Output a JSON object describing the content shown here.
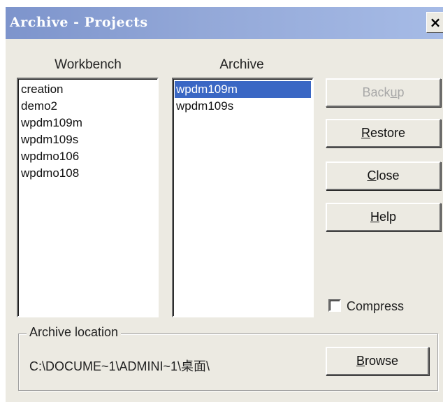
{
  "window": {
    "title": "Archive - Projects",
    "close_label": "×"
  },
  "workbench": {
    "label": "Workbench",
    "items": [
      "creation",
      "demo2",
      "wpdm109m",
      "wpdm109s",
      "wpdmo106",
      "wpdmo108"
    ]
  },
  "archive": {
    "label": "Archive",
    "items": [
      "wpdm109m",
      "wpdm109s"
    ],
    "selected": "wpdm109m"
  },
  "buttons": {
    "backup": {
      "pre": "Back",
      "mnemonic": "u",
      "post": "p",
      "enabled": false
    },
    "restore": {
      "pre": "",
      "mnemonic": "R",
      "post": "estore",
      "enabled": true
    },
    "close": {
      "pre": "",
      "mnemonic": "C",
      "post": "lose",
      "enabled": true
    },
    "help": {
      "pre": "",
      "mnemonic": "H",
      "post": "elp",
      "enabled": true
    },
    "browse": {
      "pre": "",
      "mnemonic": "B",
      "post": "rowse",
      "enabled": true
    }
  },
  "compress": {
    "label": "Compress",
    "checked": false
  },
  "location": {
    "legend": "Archive location",
    "path": "C:\\DOCUME~1\\ADMINI~1\\桌面\\"
  },
  "colors": {
    "titlebar_start": "#7d94cc",
    "titlebar_end": "#a6bbe6",
    "face": "#eceae2",
    "selection": "#3a67c4"
  }
}
